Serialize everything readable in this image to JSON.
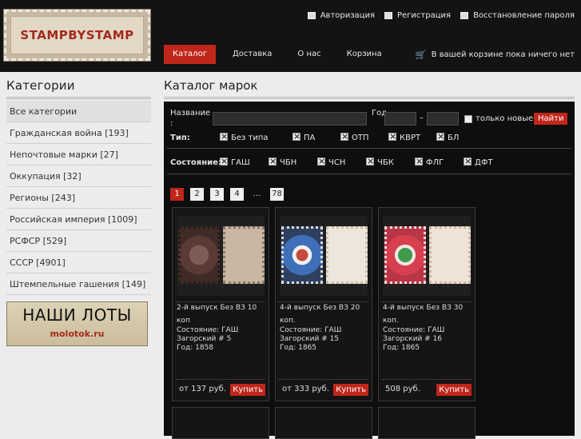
{
  "header": {
    "logo_text": "STAMPBYSTAMP",
    "toplinks": [
      "Авторизация",
      "Регистрация",
      "Восстановление пароля"
    ],
    "nav": [
      "Каталог",
      "Доставка",
      "О нас",
      "Корзина"
    ],
    "cart_text": "В вашей корзине пока ничего нет"
  },
  "sidebar": {
    "title": "Категории",
    "items": [
      "Все категории",
      "Гражданская война [193]",
      "Непочтовые марки [27]",
      "Оккупация [32]",
      "Регионы [243]",
      "Российская империя [1009]",
      "РСФСР [529]",
      "СССР [4901]",
      "Штемпельные гашения [149]"
    ],
    "banner_title": "НАШИ ЛОТЫ",
    "banner_sub": "molotok.ru"
  },
  "main": {
    "title": "Каталог марок",
    "filter": {
      "name_label": "Название :",
      "year_label": "Год",
      "dash": "–",
      "only_new": "только новые",
      "search_button": "Найти",
      "type_label": "Тип:",
      "types": [
        "Без типа",
        "ПА",
        "ОТП",
        "КВРТ",
        "БЛ"
      ],
      "state_label": "Состояние:",
      "states": [
        "ГАШ",
        "ЧБН",
        "ЧСН",
        "ЧБК",
        "ФЛГ",
        "ДФТ"
      ]
    },
    "pagination": [
      "1",
      "2",
      "3",
      "4",
      "…",
      "78"
    ],
    "products": [
      {
        "title": "2-й выпуск Без ВЗ 10 коп",
        "state": "Состояние: ГАШ",
        "catalog": "Загорский # 5",
        "year": "Год: 1858",
        "price": "от 137 руб.",
        "buy": "Купить"
      },
      {
        "title": "4-й выпуск Без ВЗ 20 коп.",
        "state": "Состояние: ГАШ",
        "catalog": "Загорский # 15",
        "year": "Год: 1865",
        "price": "от 333 руб.",
        "buy": "Купить"
      },
      {
        "title": "4-й выпуск Без ВЗ 30 коп.",
        "state": "Состояние: ГАШ",
        "catalog": "Загорский # 16",
        "year": "Год: 1865",
        "price": "508 руб.",
        "buy": "Купить"
      }
    ]
  }
}
